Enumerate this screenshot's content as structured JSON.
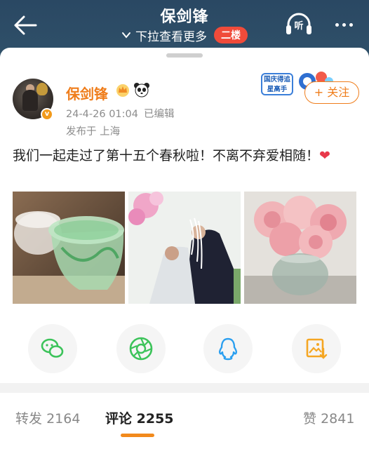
{
  "header": {
    "title": "保剑锋",
    "pull_hint": "下拉查看更多",
    "floor_badge": "二楼",
    "listen_label": "听"
  },
  "post": {
    "author": "保剑锋",
    "verified_mark": "v",
    "timestamp": "24-4-26 01:04",
    "edited": "已编辑",
    "location": "发布于 上海",
    "text": "我们一起走过了第十五个春秋啦！不离不弃爱相随！",
    "emoji": "❤",
    "promo_text": "国庆得追星高手",
    "follow_label": "+ 关注",
    "images": [
      "glasses-photo",
      "couple-photo",
      "flowers-photo"
    ]
  },
  "share": {
    "items": [
      "wechat-icon",
      "moments-icon",
      "qq-icon",
      "save-image-icon"
    ]
  },
  "tabs": {
    "repost_label": "转发",
    "repost_count": "2164",
    "comment_label": "评论",
    "comment_count": "2255",
    "like_label": "赞",
    "like_count": "2841"
  },
  "colors": {
    "topbar": "#2a4863",
    "accent_orange": "#ef7d1b",
    "badge_red": "#f04b3a",
    "wechat_green": "#3cc35a",
    "qq_blue": "#2a9ff0",
    "save_orange": "#f5a623"
  }
}
